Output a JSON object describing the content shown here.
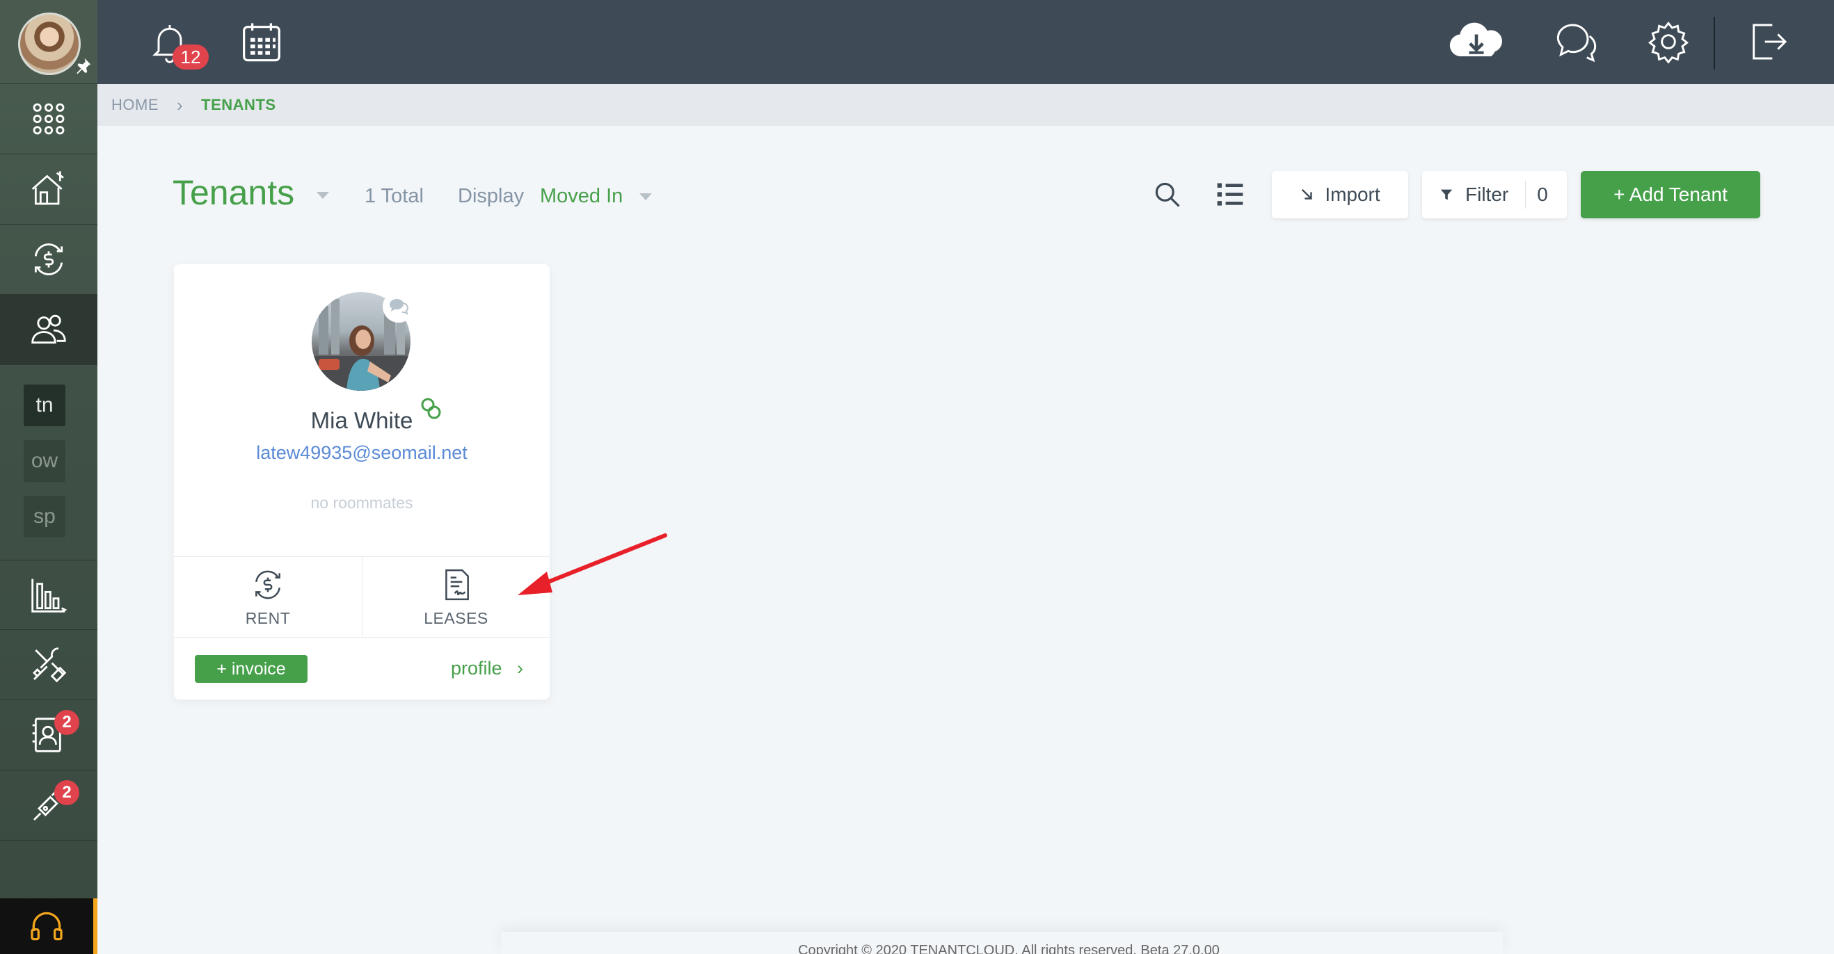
{
  "header": {
    "notification_count": "12",
    "icons": [
      "bell-icon",
      "calendar-icon",
      "cloud-download-icon",
      "chat-icon",
      "gear-icon",
      "logout-icon"
    ]
  },
  "sidebar": {
    "items": [
      {
        "name": "apps-icon"
      },
      {
        "name": "properties-icon"
      },
      {
        "name": "payments-icon"
      },
      {
        "name": "tenants-icon",
        "active": true
      },
      {
        "name": "reports-icon"
      },
      {
        "name": "maintenance-icon"
      },
      {
        "name": "applicants-icon",
        "badge": "2"
      },
      {
        "name": "listings-icon",
        "badge": "2"
      }
    ],
    "accounts": [
      "tn",
      "ow",
      "sp"
    ]
  },
  "breadcrumb": {
    "home": "HOME",
    "current": "TENANTS"
  },
  "toolbar": {
    "title": "Tenants",
    "total": "1 Total",
    "display_label": "Display",
    "display_value": "Moved In",
    "import_label": "Import",
    "filter_label": "Filter",
    "filter_count": "0",
    "add_label": "+  Add Tenant"
  },
  "tenant": {
    "name": "Mia White",
    "email": "latew49935@seomail.net",
    "roommates": "no roommates",
    "rent_label": "RENT",
    "leases_label": "LEASES",
    "invoice_label": "+ invoice",
    "profile_label": "profile"
  },
  "footer": {
    "text": "Copyright © 2020 TENANTCLOUD. All rights reserved. Beta 27.0.00"
  },
  "colors": {
    "accent": "#46a04a",
    "header_bg": "#3e4a55",
    "badge": "#e0434b",
    "annotation_arrow": "#e8202a"
  }
}
